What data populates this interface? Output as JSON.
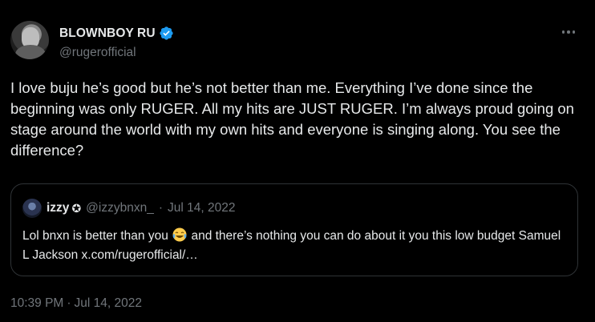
{
  "author": {
    "display_name": "BLOWNBOY RU",
    "handle": "@rugerofficial",
    "verified": true
  },
  "tweet": {
    "text": "I love buju he’s good but he’s not better than me. Everything I’ve done since the beginning was only RUGER. All my hits are JUST RUGER. I’m always proud going on stage around the world with my own hits and everyone is singing along. You see the difference?"
  },
  "quote": {
    "display_name": "izzy",
    "badge": "✪",
    "handle": "@izzybnxn_",
    "separator": "·",
    "date": "Jul 14, 2022",
    "text_before_emoji": "Lol bnxn is better than you",
    "emoji": "face-with-tears-of-joy",
    "text_after_emoji": "and there’s nothing you can do about it you this low budget Samuel L Jackson x.com/rugerofficial/…"
  },
  "meta": {
    "time": "10:39 PM",
    "separator": "·",
    "date": "Jul 14, 2022"
  },
  "colors": {
    "background": "#000000",
    "text": "#e7e9ea",
    "muted": "#71767b",
    "border": "#2f3336",
    "verified": "#1d9bf0"
  }
}
